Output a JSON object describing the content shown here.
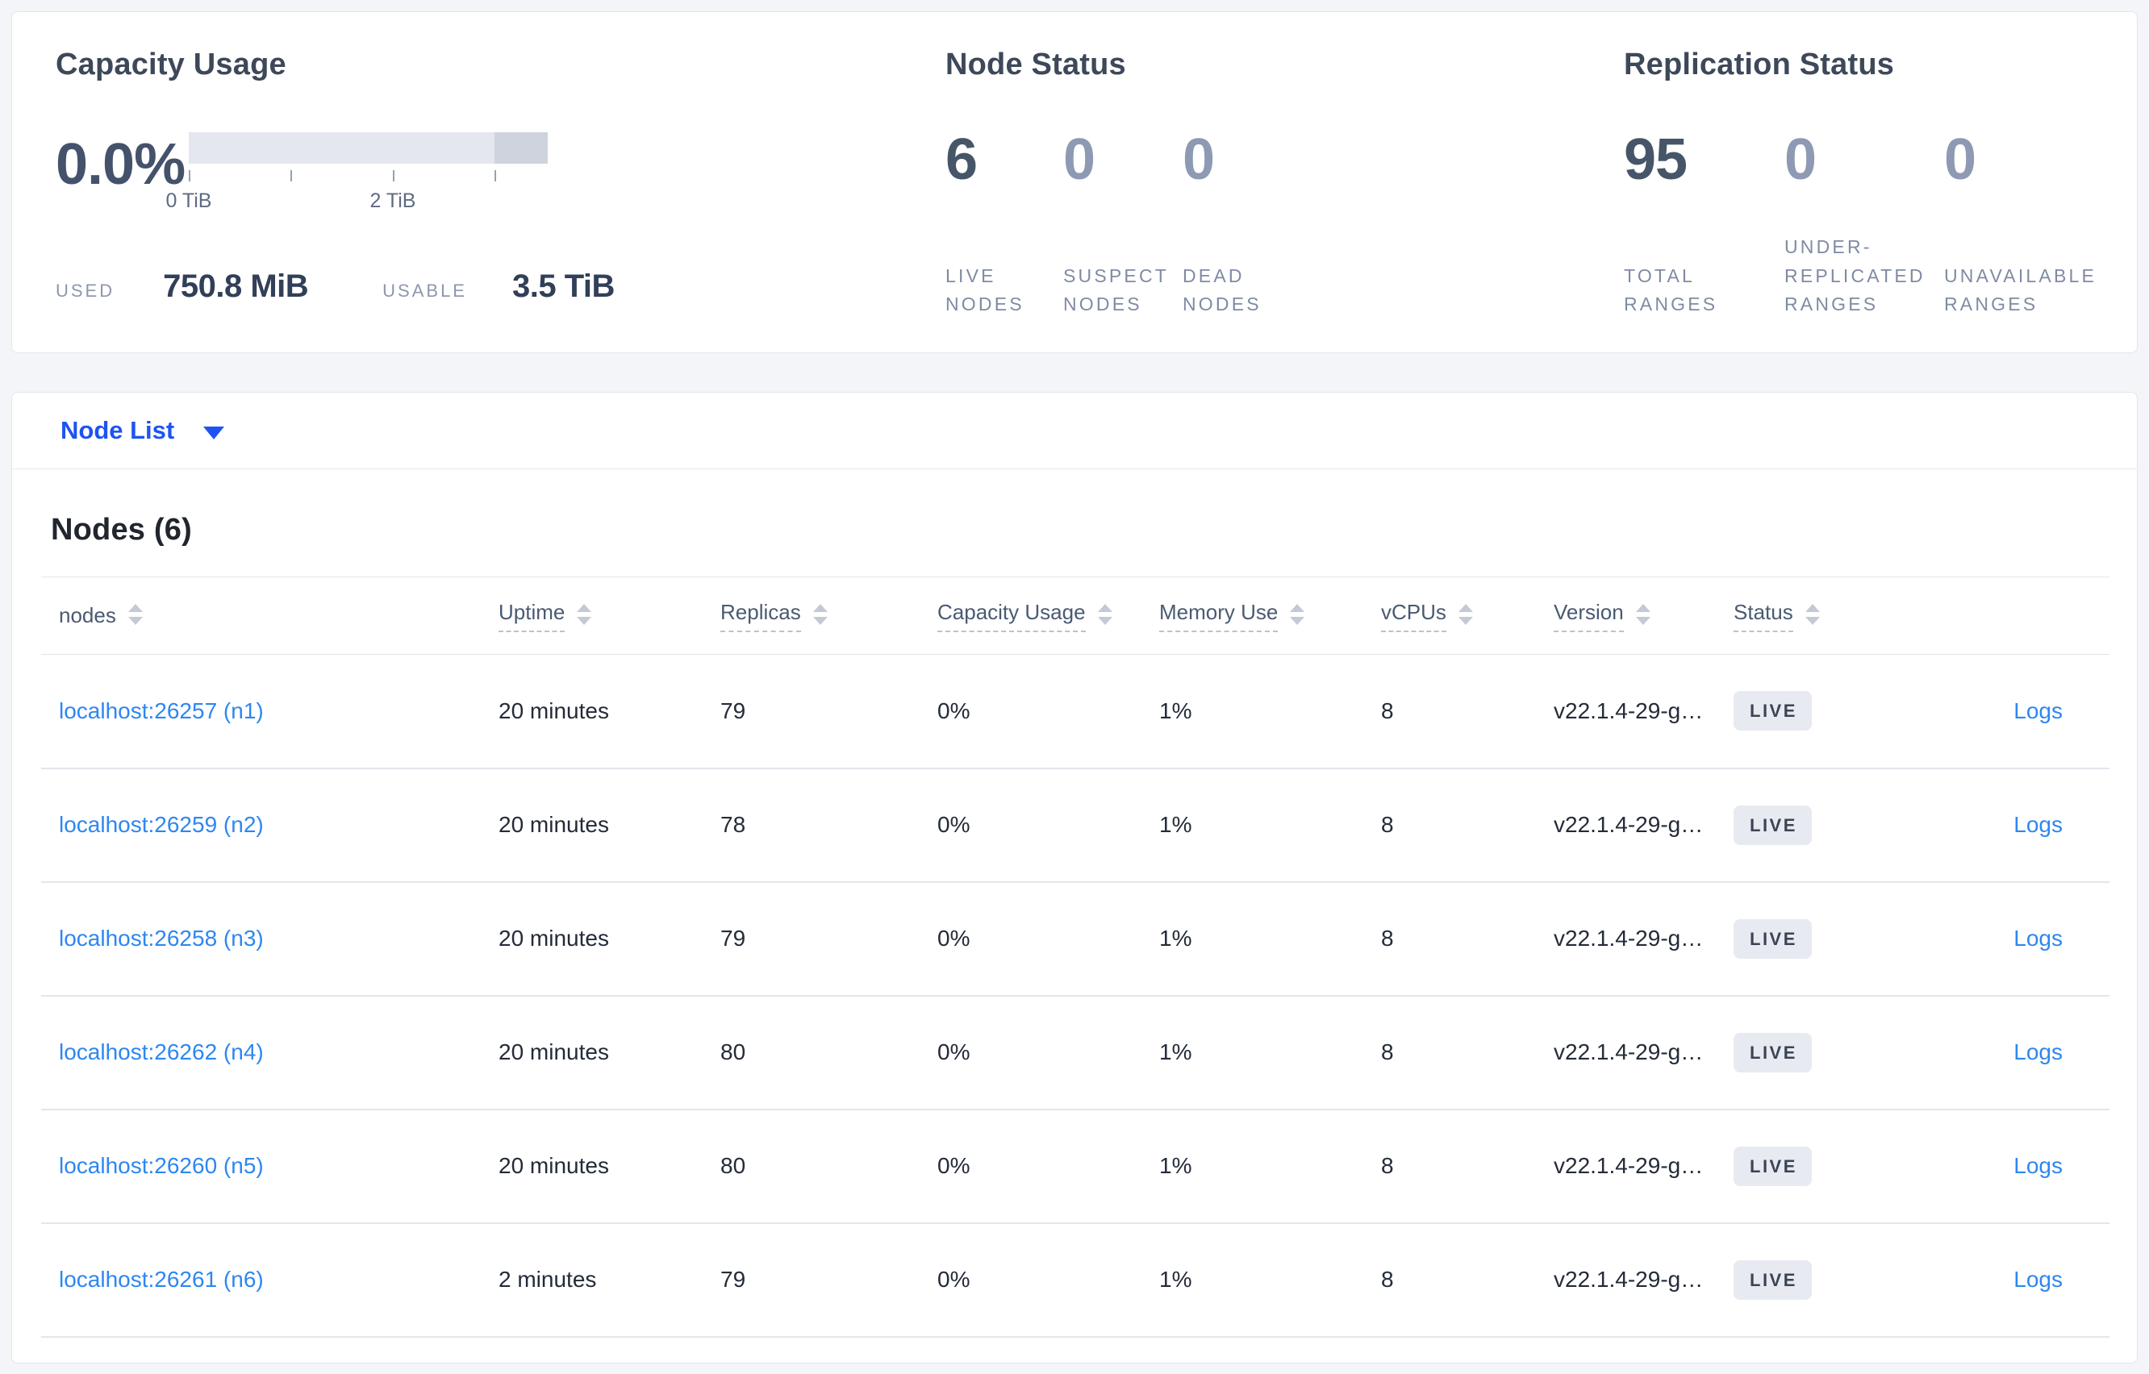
{
  "capacity": {
    "title": "Capacity Usage",
    "percent": "0.0%",
    "used_label": "USED",
    "used_value": "750.8 MiB",
    "usable_label": "USABLE",
    "usable_value": "3.5 TiB",
    "tick_label_0": "0 TiB",
    "tick_label_2": "2 TiB",
    "bar_colors": {
      "free": "#e4e7ee",
      "other": "#ced3dd"
    }
  },
  "node_status": {
    "title": "Node Status",
    "stats": [
      {
        "value": "6",
        "label": "LIVE NODES"
      },
      {
        "value": "0",
        "label": "SUSPECT NODES"
      },
      {
        "value": "0",
        "label": "DEAD NODES"
      }
    ]
  },
  "replication": {
    "title": "Replication Status",
    "stats": [
      {
        "value": "95",
        "label": "TOTAL RANGES"
      },
      {
        "value": "0",
        "label": "UNDER-REPLICATED RANGES"
      },
      {
        "value": "0",
        "label": "UNAVAILABLE RANGES"
      }
    ]
  },
  "node_list": {
    "label": "Node List",
    "caret_icon": "caret-down"
  },
  "nodes_panel": {
    "heading": "Nodes (6)",
    "sort_icon": "sort-arrows",
    "columns": [
      {
        "label": "nodes"
      },
      {
        "label": "Uptime"
      },
      {
        "label": "Replicas"
      },
      {
        "label": "Capacity Usage"
      },
      {
        "label": "Memory Use"
      },
      {
        "label": "vCPUs"
      },
      {
        "label": "Version"
      },
      {
        "label": "Status"
      }
    ],
    "rows": [
      {
        "node": "localhost:26257 (n1)",
        "uptime": "20 minutes",
        "replicas": "79",
        "capacity": "0%",
        "memory": "1%",
        "vcpus": "8",
        "version": "v22.1.4-29-g…",
        "status": "LIVE",
        "logs": "Logs"
      },
      {
        "node": "localhost:26259 (n2)",
        "uptime": "20 minutes",
        "replicas": "78",
        "capacity": "0%",
        "memory": "1%",
        "vcpus": "8",
        "version": "v22.1.4-29-g…",
        "status": "LIVE",
        "logs": "Logs"
      },
      {
        "node": "localhost:26258 (n3)",
        "uptime": "20 minutes",
        "replicas": "79",
        "capacity": "0%",
        "memory": "1%",
        "vcpus": "8",
        "version": "v22.1.4-29-g…",
        "status": "LIVE",
        "logs": "Logs"
      },
      {
        "node": "localhost:26262 (n4)",
        "uptime": "20 minutes",
        "replicas": "80",
        "capacity": "0%",
        "memory": "1%",
        "vcpus": "8",
        "version": "v22.1.4-29-g…",
        "status": "LIVE",
        "logs": "Logs"
      },
      {
        "node": "localhost:26260 (n5)",
        "uptime": "20 minutes",
        "replicas": "80",
        "capacity": "0%",
        "memory": "1%",
        "vcpus": "8",
        "version": "v22.1.4-29-g…",
        "status": "LIVE",
        "logs": "Logs"
      },
      {
        "node": "localhost:26261 (n6)",
        "uptime": "2 minutes",
        "replicas": "79",
        "capacity": "0%",
        "memory": "1%",
        "vcpus": "8",
        "version": "v22.1.4-29-g…",
        "status": "LIVE",
        "logs": "Logs"
      }
    ]
  }
}
